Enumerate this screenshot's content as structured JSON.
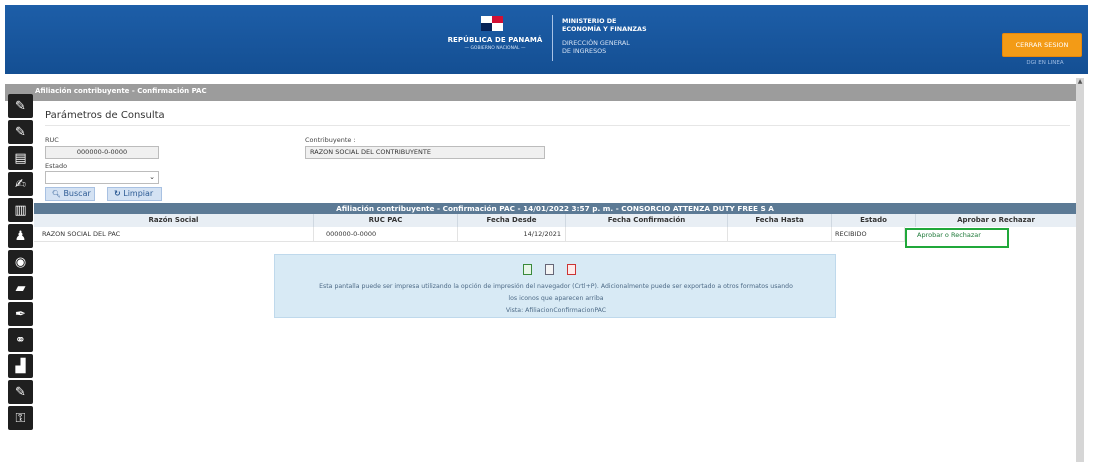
{
  "header": {
    "republic_title": "REPÚBLICA DE PANAMÁ",
    "republic_sub": "— GOBIERNO NACIONAL —",
    "ministry_title_lines": [
      "MINISTERIO DE",
      "ECONOMÍA Y FINANZAS"
    ],
    "ministry_sub_lines": [
      "DIRECCIÓN GENERAL",
      "DE INGRESOS"
    ],
    "logout_label": "CERRAR SESION",
    "dgi_label": "DGI EN LINEA"
  },
  "page": {
    "breadcrumb": "Afiliación contribuyente - Confirmación PAC",
    "section_title": "Parámetros de Consulta"
  },
  "form": {
    "ruc_label": "RUC",
    "ruc_value": "000000-0-0000",
    "contribuyente_label": "Contribuyente :",
    "contribuyente_value": "RAZON SOCIAL DEL CONTRIBUYENTE",
    "estado_label": "Estado",
    "estado_value": "",
    "search_button": "Buscar",
    "clear_button": "Limpiar"
  },
  "table": {
    "caption": "Afiliación contribuyente - Confirmación PAC - 14/01/2022 3:57 p. m. - CONSORCIO ATTENZA DUTY FREE S A",
    "headers": [
      "Razón Social",
      "RUC PAC",
      "Fecha Desde",
      "Fecha Confirmación",
      "Fecha Hasta",
      "Estado",
      "Aprobar o Rechazar"
    ],
    "rows": [
      {
        "razon_social": "RAZON SOCIAL DEL PAC",
        "ruc_pac": "000000-0-0000",
        "fecha_desde": "14/12/2021",
        "fecha_confirmacion": "",
        "fecha_hasta": "",
        "estado": "RECIBIDO",
        "accion": "Aprobar o Rechazar"
      }
    ]
  },
  "info": {
    "line1": "Esta pantalla puede ser impresa utilizando la opción de impresión del navegador (Crtl+P). Adicionalmente puede ser exportado a otros formatos usando",
    "line2": "los iconos que aparecen arriba",
    "line3": "Vista: AfiliacionConfirmacionPAC"
  },
  "colors": {
    "header_blue": "#1b5aa3",
    "accent_orange": "#f39b16",
    "table_caption": "#5c7a95",
    "highlight_green": "#20a83a"
  },
  "icons": {
    "sidebar": [
      "edit-icon",
      "edit-icon",
      "id-card-icon",
      "document-edit-icon",
      "building-icon",
      "user-icon",
      "money-bag-icon",
      "folder-icon",
      "signature-icon",
      "handshake-icon",
      "user-chart-icon",
      "document-edit-icon",
      "lock-icon"
    ],
    "export": [
      "excel-icon",
      "csv-icon",
      "pdf-icon"
    ]
  }
}
